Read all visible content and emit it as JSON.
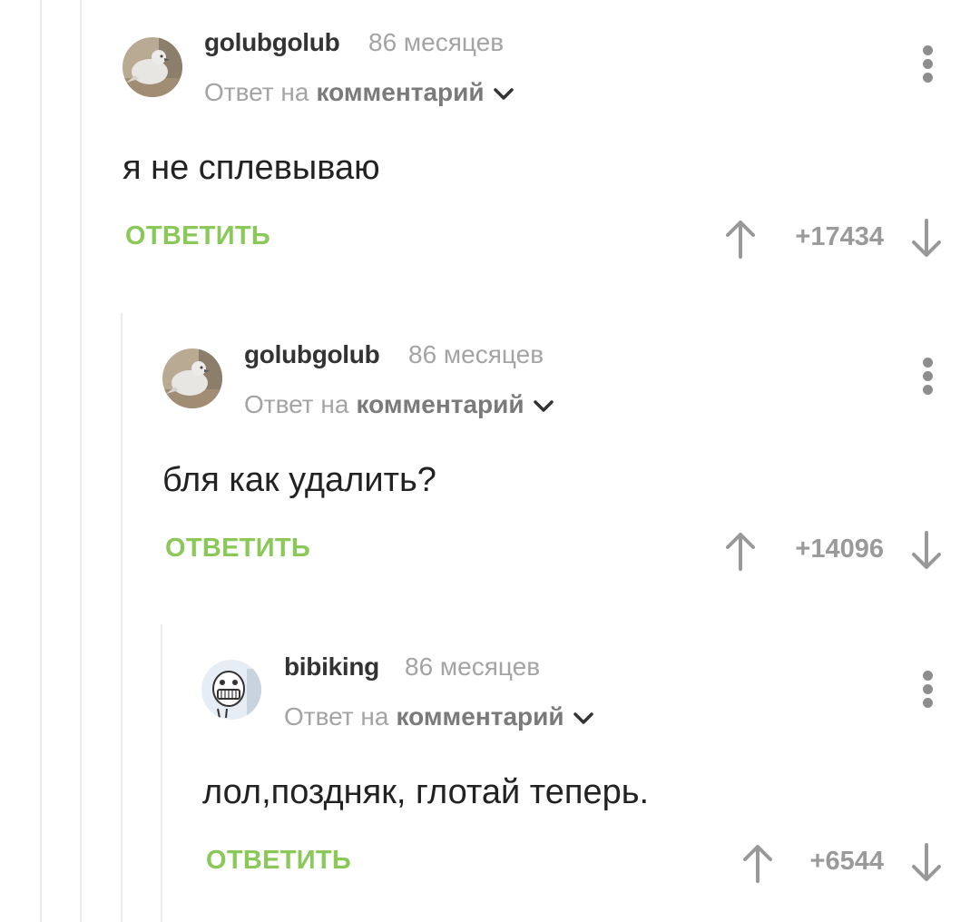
{
  "comments": [
    {
      "author": "golubgolub",
      "time": "86 месяцев",
      "reply_prefix": "Ответ на",
      "reply_target": "комментарий",
      "text": "я не сплевываю",
      "reply_label": "ОТВЕТИТЬ",
      "score": "+17434",
      "avatar_icon": "pigeon-avatar"
    },
    {
      "author": "golubgolub",
      "time": "86 месяцев",
      "reply_prefix": "Ответ на",
      "reply_target": "комментарий",
      "text": "бля как удалить?",
      "reply_label": "ОТВЕТИТЬ",
      "score": "+14096",
      "avatar_icon": "pigeon-avatar"
    },
    {
      "author": "bibiking",
      "time": "86 месяцев",
      "reply_prefix": "Ответ на",
      "reply_target": "комментарий",
      "text": "лол,поздняк, глотай теперь.",
      "reply_label": "ОТВЕТИТЬ",
      "score": "+6544",
      "avatar_icon": "cartoon-face-avatar"
    }
  ],
  "colors": {
    "accent_green": "#8ac858",
    "muted_gray": "#a4a4a4",
    "text_dark": "#222222",
    "thread_line": "#ececec"
  }
}
